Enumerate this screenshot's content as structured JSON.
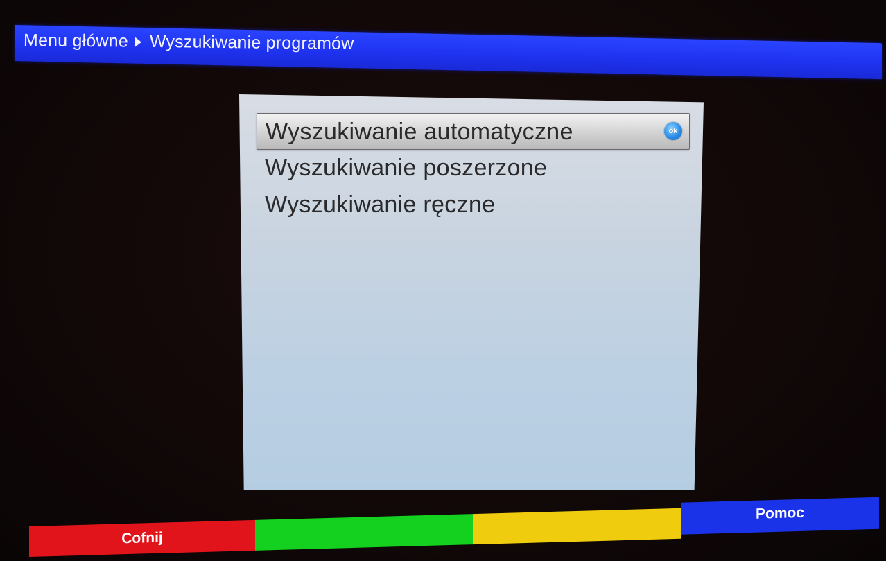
{
  "header": {
    "breadcrumb_root": "Menu główne",
    "breadcrumb_current": "Wyszukiwanie programów"
  },
  "menu": {
    "items": [
      {
        "label": "Wyszukiwanie automatyczne",
        "selected": true
      },
      {
        "label": "Wyszukiwanie poszerzone",
        "selected": false
      },
      {
        "label": "Wyszukiwanie ręczne",
        "selected": false
      }
    ],
    "ok_icon_text": "ok"
  },
  "keys": {
    "red_label": "Cofnij",
    "green_label": "",
    "yellow_label": "",
    "blue_label": "Pomoc"
  },
  "colors": {
    "header_blue": "#1f33f0",
    "red": "#e1141b",
    "green": "#13d11e",
    "yellow": "#f0cc0f",
    "blue": "#1a33e8"
  }
}
